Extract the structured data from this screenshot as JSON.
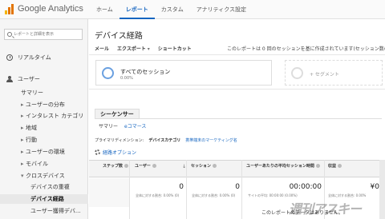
{
  "app": {
    "name": "Google Analytics"
  },
  "topnav": [
    "ホーム",
    "レポート",
    "カスタム",
    "アナリティクス設定"
  ],
  "sidebar": {
    "search_placeholder": "レポートと詳細を表示",
    "realtime": "リアルタイム",
    "users": "ユーザー",
    "items": [
      "サマリー",
      "ユーザーの分布",
      "インタレスト カテゴリ",
      "地域",
      "行動",
      "ユーザーの環境",
      "モバイル",
      "クロスデバイス"
    ],
    "subitems": [
      "デバイスの重複",
      "デバイス経路",
      "ユーザー獲得デバ..."
    ]
  },
  "main": {
    "title": "デバイス経路",
    "toolbar": [
      "メール",
      "エクスポート",
      "ショートカット"
    ],
    "sample_note": "このレポートは 0 回のセッションを基に作成されています(セッション数の 10",
    "segment": {
      "name": "すべてのセッション",
      "pct": "0.00%"
    },
    "add_segment": "+ セグメント",
    "tab": "シーケンサー",
    "subtabs": [
      "サマリー",
      "eコマース"
    ],
    "dims": {
      "label": "プライマリディメンション:",
      "active": "デバイスカテゴリ",
      "link": "携帯端末のマーケティング名"
    },
    "path_options": "経路オプション"
  },
  "table": {
    "headers": [
      "ステップ数",
      "ユーザー",
      "セッション",
      "ユーザーあたりの平均セッション時間",
      "収益"
    ],
    "values": [
      "0",
      "0",
      "00:00:00",
      "¥0"
    ],
    "subs": [
      "全体に対する割合: 0.00% (0)",
      "全体に対する割合: 0.00% (0)",
      "サイトの平均: 00:00:00 (0.00%)",
      "全体に対する割合: 0.00%"
    ],
    "no_data": "このレポートのデータはありません。"
  },
  "watermark": "週刊アスキー",
  "colors": {
    "accent": "#1565c0",
    "segment_ring": "#6aa0e0",
    "logo_orange": "#e37400"
  }
}
